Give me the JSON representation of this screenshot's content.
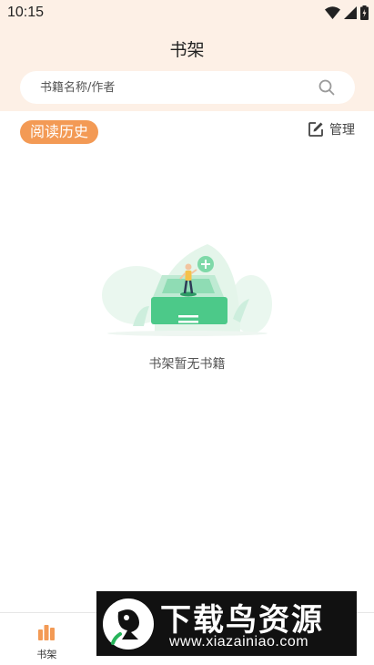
{
  "status_bar": {
    "time": "10:15"
  },
  "header": {
    "title": "书架"
  },
  "search": {
    "placeholder": "书籍名称/作者"
  },
  "section": {
    "history_label": "阅读历史",
    "manage_label": "管理"
  },
  "empty_state": {
    "message": "书架暂无书籍"
  },
  "bottom_nav": {
    "items": [
      {
        "label": "书架",
        "icon": "bookshelf-icon",
        "active": true
      },
      {
        "label": "",
        "icon": "nav-icon-2",
        "active": false
      },
      {
        "label": "",
        "icon": "nav-icon-3",
        "active": false
      },
      {
        "label": "",
        "icon": "nav-icon-4",
        "active": false
      }
    ]
  },
  "watermark": {
    "title": "下载鸟资源",
    "url": "www.xiazainiao.com"
  },
  "colors": {
    "header_bg": "#fdf0e6",
    "accent": "#f39a55",
    "illustration_green": "#4cc989"
  }
}
